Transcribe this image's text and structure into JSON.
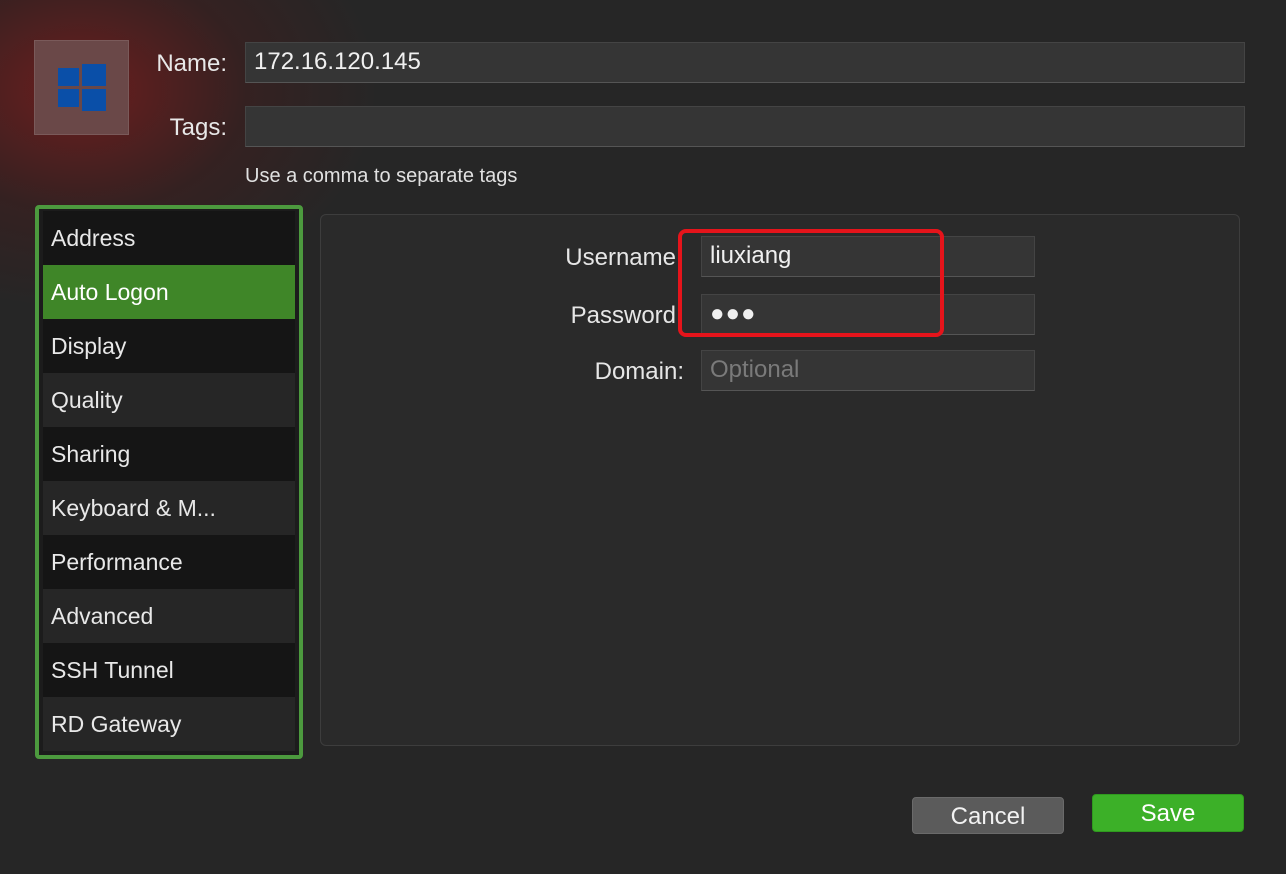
{
  "header": {
    "name_label": "Name:",
    "name_value": "172.16.120.145",
    "tags_label": "Tags:",
    "tags_value": "",
    "tags_hint": "Use a comma to separate tags",
    "icon": "windows-logo-icon"
  },
  "sidebar": {
    "items": [
      {
        "label": "Address"
      },
      {
        "label": "Auto Logon"
      },
      {
        "label": "Display"
      },
      {
        "label": "Quality"
      },
      {
        "label": "Sharing"
      },
      {
        "label": "Keyboard & M..."
      },
      {
        "label": "Performance"
      },
      {
        "label": "Advanced"
      },
      {
        "label": "SSH Tunnel"
      },
      {
        "label": "RD Gateway"
      }
    ],
    "selected": "Auto Logon"
  },
  "auto_logon": {
    "username_label": "Username",
    "username_value": "liuxiang",
    "password_label": "Password",
    "password_value": "●●●",
    "domain_label": "Domain:",
    "domain_placeholder": "Optional"
  },
  "footer": {
    "cancel_label": "Cancel",
    "save_label": "Save"
  },
  "colors": {
    "accent_green": "#3f8628",
    "save_green": "#3cb028",
    "highlight_red": "#e5141b",
    "windows_blue": "#0a4fa8"
  }
}
